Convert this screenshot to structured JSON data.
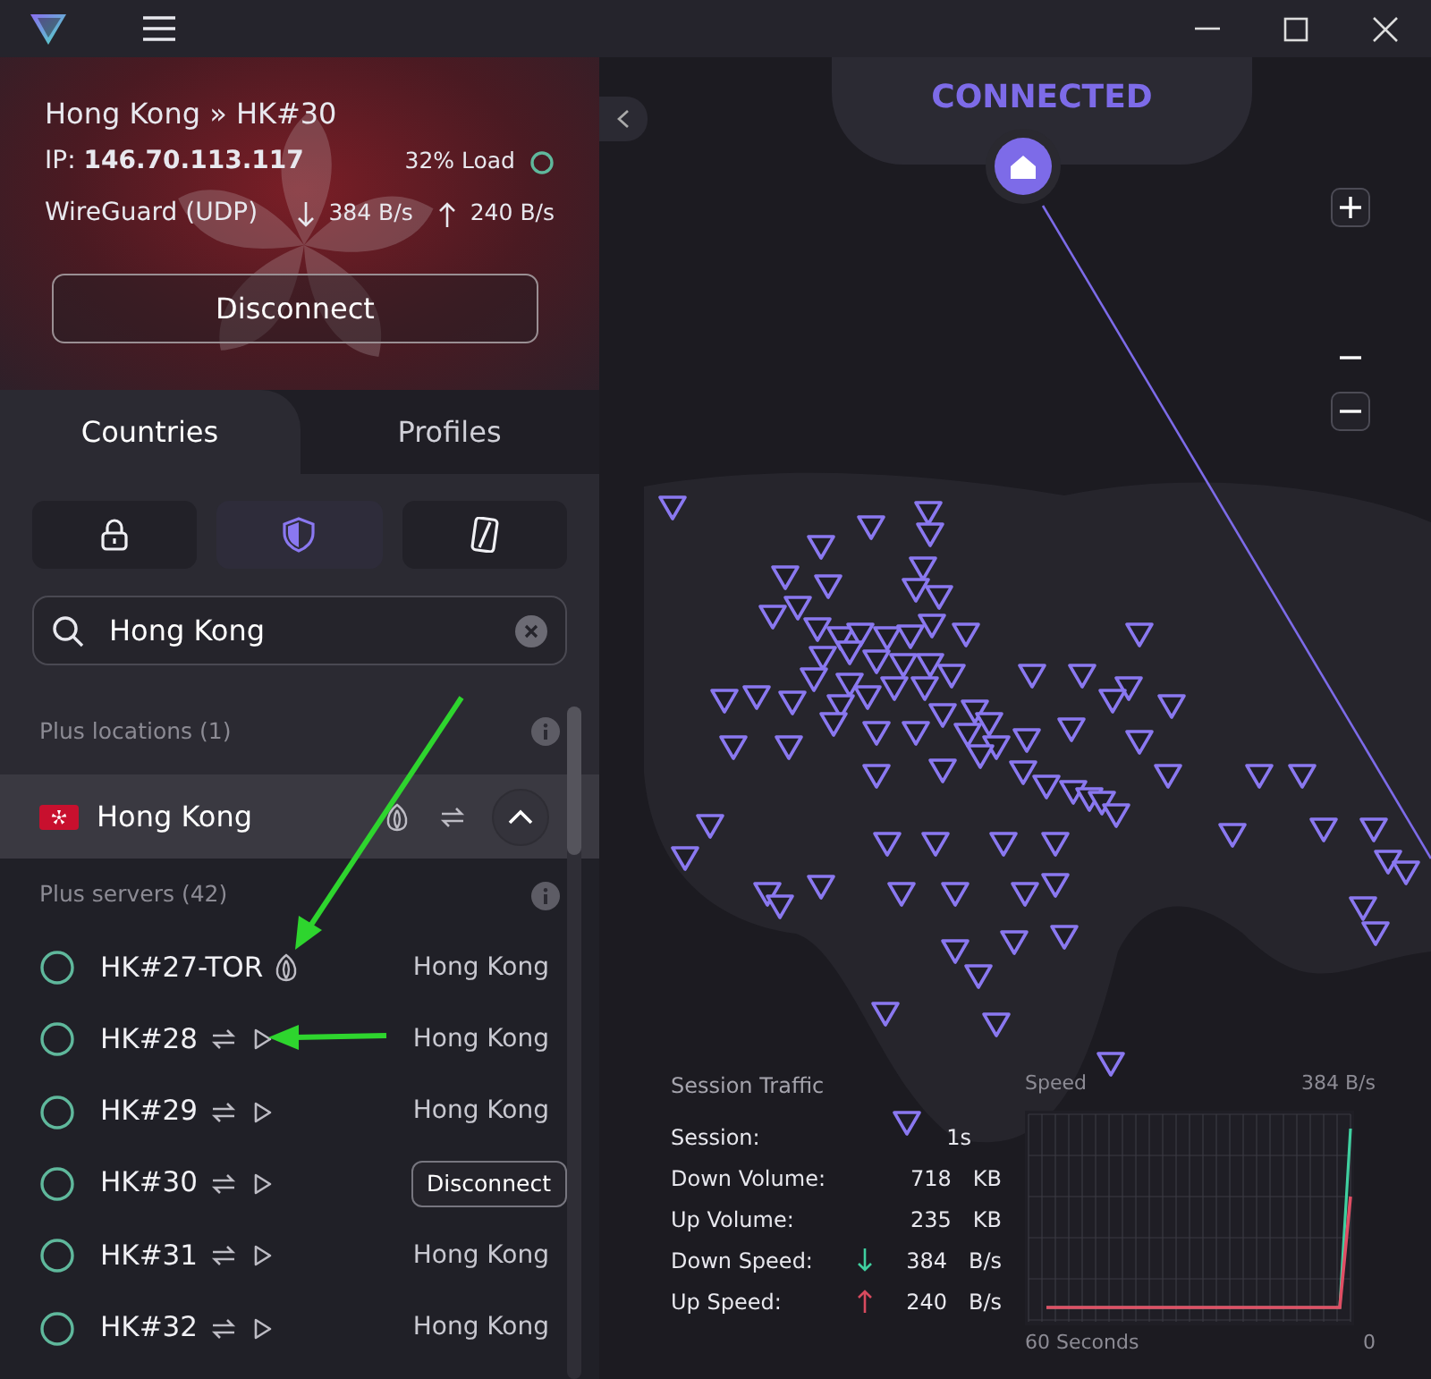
{
  "connection": {
    "title": "Hong Kong » HK#30",
    "ip_label": "IP:",
    "ip": "146.70.113.117",
    "load": "32% Load",
    "protocol": "WireGuard (UDP)",
    "down": "384 B/s",
    "up": "240 B/s",
    "button": "Disconnect"
  },
  "tabs": [
    {
      "label": "Countries",
      "selected": true
    },
    {
      "label": "Profiles",
      "selected": false
    }
  ],
  "filters": [
    {
      "kind": "lock",
      "selected": false
    },
    {
      "kind": "shield",
      "selected": true
    },
    {
      "kind": "device",
      "selected": false
    }
  ],
  "search": {
    "value": "Hong Kong"
  },
  "locations_heading": "Plus locations (1)",
  "country": {
    "name": "Hong Kong",
    "expanded": true,
    "tor": true,
    "p2p": true
  },
  "servers_heading": "Plus servers (42)",
  "servers": [
    {
      "name": "HK#27-TOR",
      "tor": true,
      "p2p": false,
      "streaming": false,
      "city": "Hong Kong",
      "connected": false
    },
    {
      "name": "HK#28",
      "tor": false,
      "p2p": true,
      "streaming": true,
      "city": "Hong Kong",
      "connected": false
    },
    {
      "name": "HK#29",
      "tor": false,
      "p2p": true,
      "streaming": true,
      "city": "Hong Kong",
      "connected": false
    },
    {
      "name": "HK#30",
      "tor": false,
      "p2p": true,
      "streaming": true,
      "button": "Disconnect",
      "connected": true
    },
    {
      "name": "HK#31",
      "tor": false,
      "p2p": true,
      "streaming": true,
      "city": "Hong Kong",
      "connected": false
    },
    {
      "name": "HK#32",
      "tor": false,
      "p2p": true,
      "streaming": true,
      "city": "Hong Kong",
      "connected": false
    }
  ],
  "map": {
    "status": "CONNECTED"
  },
  "traffic": {
    "title": "Session Traffic",
    "rows": [
      {
        "label": "Session:",
        "value": "1s"
      },
      {
        "label": "Down Volume:",
        "value": "718",
        "unit": "KB"
      },
      {
        "label": "Up Volume:",
        "value": "235",
        "unit": "KB"
      },
      {
        "label": "Down Speed:",
        "value": "384",
        "unit": "B/s",
        "kind": "down"
      },
      {
        "label": "Up Speed:",
        "value": "240",
        "unit": "B/s",
        "kind": "up"
      }
    ]
  },
  "speed": {
    "title": "Speed",
    "max": "384  B/s",
    "x_start": "60 Seconds",
    "x_end": "0"
  }
}
